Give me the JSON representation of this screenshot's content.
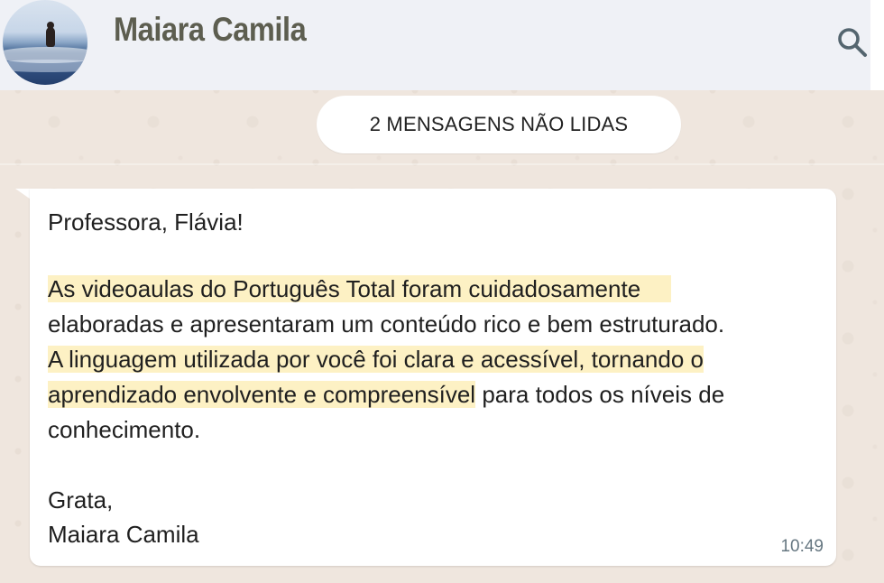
{
  "header": {
    "contact_name": "Maiara Camila",
    "search_icon": "search-icon",
    "background_color": "#eff1f6"
  },
  "unread_banner": {
    "label": "2 MENSAGENS NÃO LIDAS"
  },
  "message": {
    "greeting": "Professora, Flávia!",
    "body_lines": [
      "As videoaulas do Português Total foram cuidadosamente",
      "elaboradas e apresentaram um conteúdo rico e bem estruturado.",
      "A linguagem utilizada por você foi clara e acessível, tornando o",
      "aprendizado envolvente e compreensível",
      " para todos os níveis de",
      "conhecimento."
    ],
    "signoff": "Grata,",
    "signature": "Maiara Camila",
    "time": "10:49",
    "highlight_color": "#fdf1c4"
  },
  "colors": {
    "chat_background": "#efe6de",
    "bubble": "#ffffff",
    "name_text": "#5d5e50",
    "timestamp": "#667781"
  }
}
